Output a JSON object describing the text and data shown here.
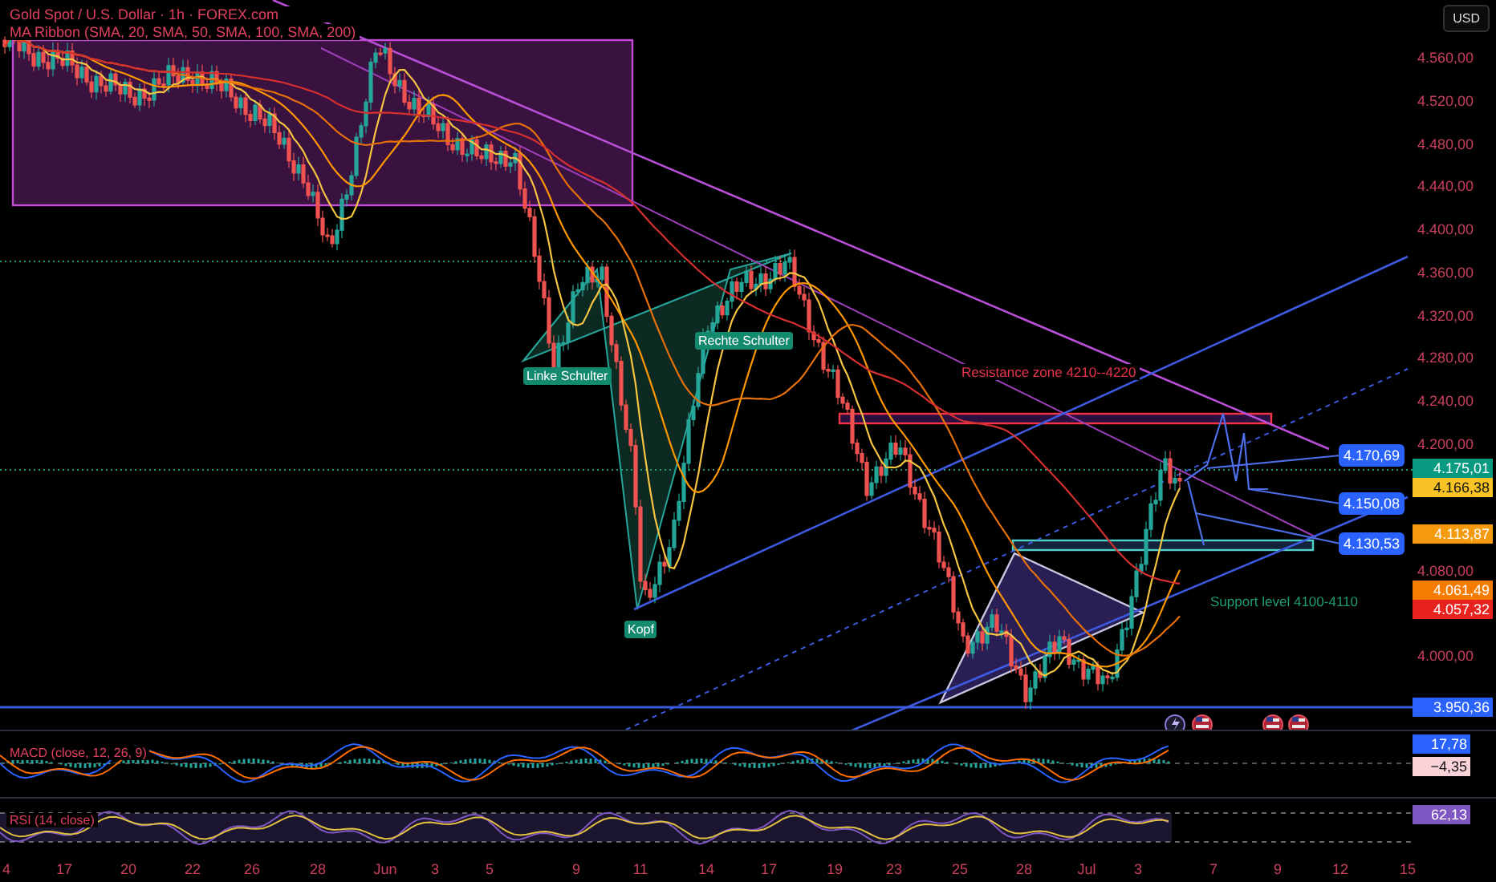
{
  "header": {
    "symbol": "Gold Spot / U.S. Dollar · 1h · FOREX.com",
    "indicator": "MA Ribbon (SMA, 20, SMA, 50, SMA, 100, SMA, 200)"
  },
  "currency_button": "USD",
  "price_axis": [
    "4.560,00",
    "4.520,00",
    "4.480,00",
    "4.440,00",
    "4.400,00",
    "4.360,00",
    "4.320,00",
    "4.280,00",
    "4.240,00",
    "4.200,00",
    "4.080,00",
    "4.000,00"
  ],
  "price_badges": [
    {
      "value": "4.175,01",
      "color": "#089981"
    },
    {
      "value": "4.166,38",
      "color": "#f7c325"
    },
    {
      "value": "4.113,87",
      "color": "#f59a0c"
    },
    {
      "value": "4.061,49",
      "color": "#f57c00"
    },
    {
      "value": "4.057,32",
      "color": "#e8231f"
    },
    {
      "value": "3.950,36",
      "color": "#2962ff"
    }
  ],
  "annotations": [
    {
      "kind": "tag",
      "text": "Linke Schulter",
      "color": "#138a6e"
    },
    {
      "kind": "tag",
      "text": "Rechte Schulter",
      "color": "#138a6e"
    },
    {
      "kind": "tag",
      "text": "Kopf",
      "color": "#138a6e"
    },
    {
      "kind": "note",
      "text": "Resistance zone 4210--4220",
      "color": "#e8334a"
    },
    {
      "kind": "note",
      "text": "Support level 4100-4110",
      "color": "#1f9c72"
    }
  ],
  "target_labels": [
    "4.170,69",
    "4.150,08",
    "4.130,53"
  ],
  "events": [
    {
      "kind": "lightning"
    },
    {
      "kind": "flag"
    },
    {
      "kind": "flag"
    },
    {
      "kind": "flag"
    }
  ],
  "macd": {
    "label": "MACD (close, 12, 26, 9)",
    "badges": [
      {
        "value": "17,78",
        "color": "#2962ff"
      },
      {
        "value": "−4,35",
        "color": "#f8d2d6"
      }
    ]
  },
  "rsi": {
    "label": "RSI (14, close)",
    "badges": [
      {
        "value": "62,13",
        "color": "#7e57c2"
      }
    ]
  },
  "time_axis": [
    "4",
    "17",
    "20",
    "22",
    "26",
    "28",
    "Jun",
    "3",
    "5",
    "9",
    "11",
    "14",
    "17",
    "19",
    "23",
    "25",
    "28",
    "Jul",
    "3",
    "7",
    "9",
    "12",
    "15"
  ]
}
